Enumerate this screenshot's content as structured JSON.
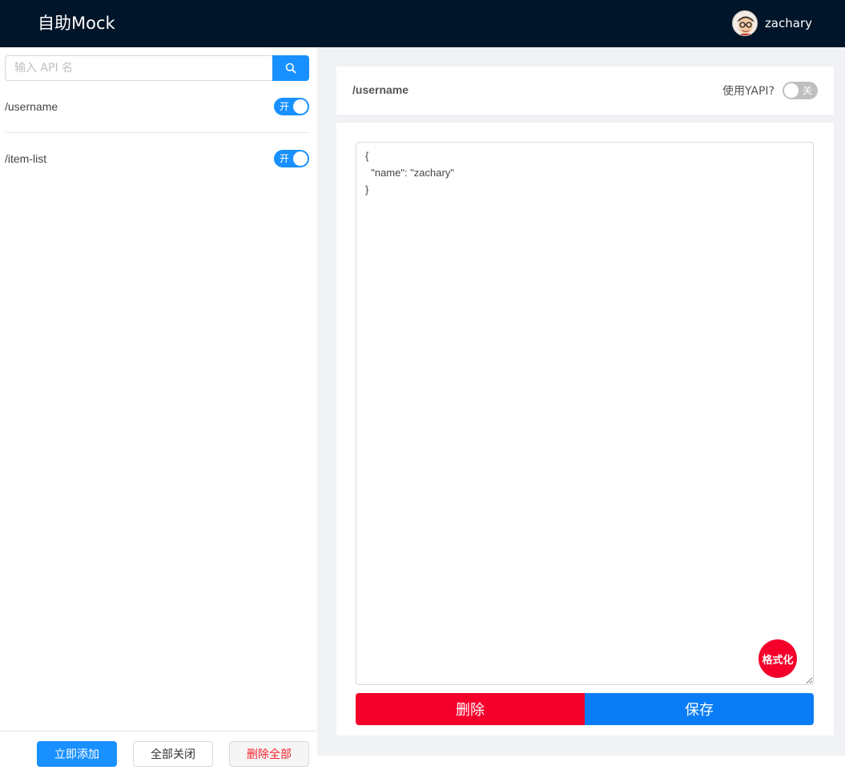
{
  "header": {
    "brand": "自助Mock",
    "user": {
      "name": "zachary",
      "avatar_icon": "avatar-icon"
    }
  },
  "sidebar": {
    "search": {
      "placeholder": "输入 API 名",
      "value": "",
      "button_icon": "search-icon"
    },
    "apis": [
      {
        "path": "/username",
        "switch_label": "开",
        "enabled": true
      },
      {
        "path": "/item-list",
        "switch_label": "开",
        "enabled": true
      }
    ],
    "footer": {
      "add_label": "立即添加",
      "close_all_label": "全部关闭",
      "delete_all_label": "删除全部"
    }
  },
  "main": {
    "api_title": "/username",
    "yapi": {
      "label": "使用YAPI?",
      "switch_label": "关",
      "enabled": false
    },
    "editor_content": "{\n  \"name\": \"zachary\"\n}",
    "format_label": "格式化",
    "delete_label": "删除",
    "save_label": "保存"
  },
  "colors": {
    "header_bg": "#001529",
    "primary": "#1890ff",
    "danger": "#f5002a",
    "save": "#0a7cf5",
    "main_bg": "#f0f2f5"
  }
}
